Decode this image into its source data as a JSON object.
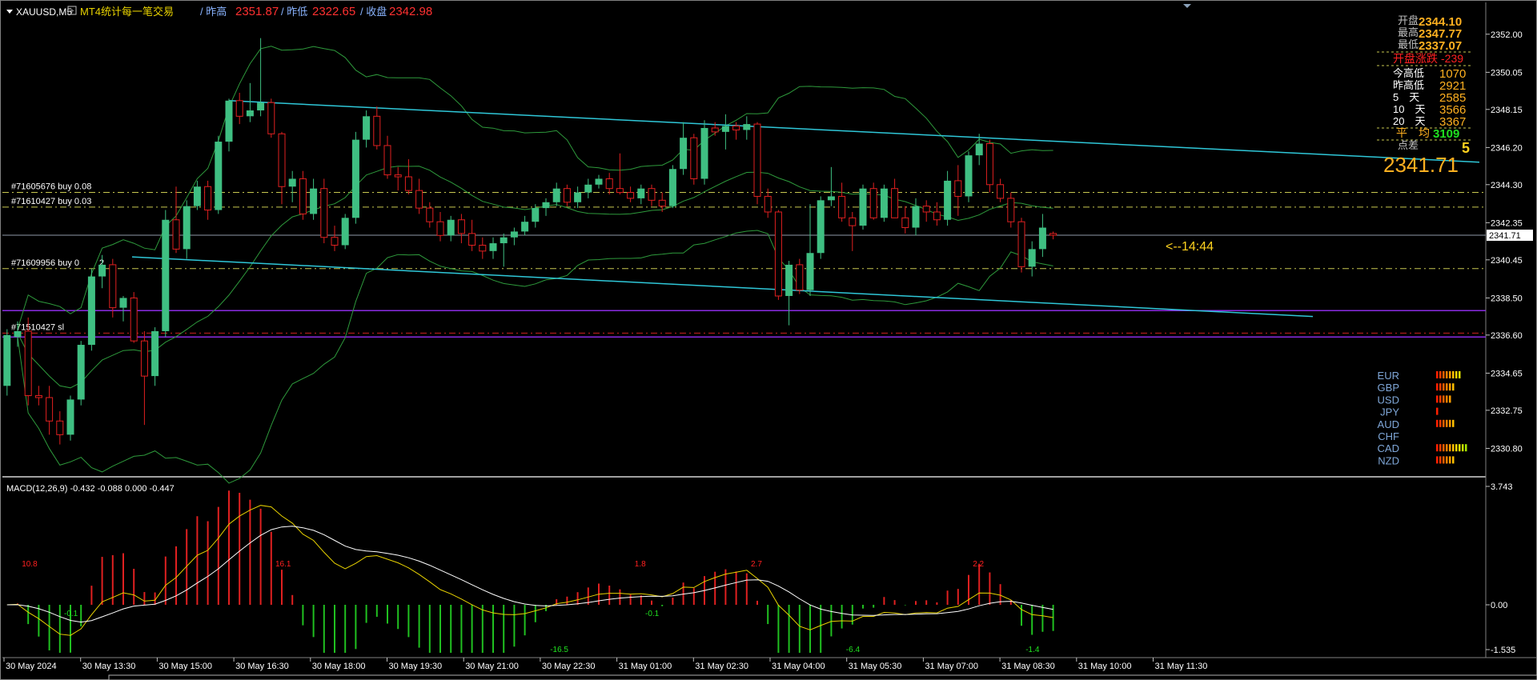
{
  "header": {
    "symbol": "XAUUSD,M5",
    "indicator_title": "MT4统计每一笔交易",
    "prev_high_label": "/ 昨高",
    "prev_high_value": "2351.87",
    "prev_low_label": "/ 昨低",
    "prev_low_value": "2322.65",
    "close_label": "/ 收盘",
    "close_value": "2342.98"
  },
  "colors": {
    "bull": "#3fbf82",
    "bear": "#e02020",
    "channel": "#2fc7d8",
    "bands": "#2e9a3c",
    "macd_signal": "#e8d200",
    "macd_main": "#ffffff",
    "orders": "#c8c850",
    "sl": "#d02020",
    "purple": "#8a2be2",
    "info_yellow": "#ffb020",
    "info_red": "#ff2020",
    "info_green": "#20e020"
  },
  "price_axis": {
    "ticks": [
      "2352.00",
      "2350.05",
      "2348.15",
      "2346.20",
      "2344.30",
      "2342.35",
      "2340.45",
      "2338.50",
      "2336.60",
      "2334.65",
      "2332.75",
      "2330.80"
    ],
    "current_price": "2341.71"
  },
  "orders": [
    {
      "label": "#71605676 buy 0.08",
      "price": 2343.9
    },
    {
      "label": "#71610427 buy 0.03",
      "price": 2343.15
    },
    {
      "label": "#71609956 buy 0",
      "price": 2340.0
    },
    {
      "label": "#71510427 sl",
      "price": 2336.7
    }
  ],
  "order_extra_char": "2",
  "countdown": "<--14:44",
  "info_panel": {
    "open_label": "开盘",
    "open_value": "2344.10",
    "high_label": "最高",
    "high_value": "2347.77",
    "low_label": "最低",
    "low_value": "2337.07",
    "open_change_label": "开盘涨跌",
    "open_change_value": "-239",
    "rows": [
      {
        "label": "今高低",
        "value": "1070"
      },
      {
        "label": "昨高低",
        "value": "2921"
      },
      {
        "label": "5　天",
        "value": "2585"
      },
      {
        "label": "10　天",
        "value": "3566"
      },
      {
        "label": "20　天",
        "value": "3367"
      }
    ],
    "avg_label": "平　均",
    "avg_value": "3109",
    "spread_label": "点差",
    "spread_value": "5",
    "big_price": "2341.71"
  },
  "currencies": [
    {
      "name": "EUR",
      "level": 8
    },
    {
      "name": "GBP",
      "level": 6
    },
    {
      "name": "USD",
      "level": 5
    },
    {
      "name": "JPY",
      "level": 1
    },
    {
      "name": "AUD",
      "level": 6
    },
    {
      "name": "CHF",
      "level": 0
    },
    {
      "name": "CAD",
      "level": 10
    },
    {
      "name": "NZD",
      "level": 6
    }
  ],
  "macd": {
    "title": "MACD(12,26,9) -0.432 -0.088 0.000 -0.447",
    "axis_top": "3.743",
    "axis_zero": "0.00",
    "axis_bottom": "-1.535",
    "labels": [
      {
        "text": "10.8",
        "bar": 2,
        "color": "red",
        "pos": "above"
      },
      {
        "text": "-0.1",
        "bar": 6,
        "color": "green",
        "pos": "below"
      },
      {
        "text": "16.1",
        "bar": 26,
        "color": "red",
        "pos": "above"
      },
      {
        "text": "-16.5",
        "bar": 52,
        "color": "green",
        "pos": "below"
      },
      {
        "text": "1.8",
        "bar": 60,
        "color": "red",
        "pos": "above"
      },
      {
        "text": "-0.1",
        "bar": 61,
        "color": "green",
        "pos": "below"
      },
      {
        "text": "2.7",
        "bar": 71,
        "color": "red",
        "pos": "above"
      },
      {
        "text": "-6.4",
        "bar": 80,
        "color": "green",
        "pos": "below"
      },
      {
        "text": "2.2",
        "bar": 92,
        "color": "red",
        "pos": "above"
      },
      {
        "text": "-1.4",
        "bar": 97,
        "color": "green",
        "pos": "below"
      }
    ]
  },
  "time_axis": [
    "30 May 2024",
    "30 May 13:30",
    "30 May 15:00",
    "30 May 16:30",
    "30 May 18:00",
    "30 May 19:30",
    "30 May 21:00",
    "30 May 22:30",
    "31 May 01:00",
    "31 May 02:30",
    "31 May 04:00",
    "31 May 05:30",
    "31 May 07:00",
    "31 May 08:30",
    "31 May 10:00",
    "31 May 11:30"
  ],
  "chart_data": {
    "type": "candlestick",
    "timeframe": "M5",
    "ohlc": [
      [
        2334,
        2336.9,
        2333.5,
        2336.6
      ],
      [
        2336.5,
        2337.3,
        2336,
        2336.8
      ],
      [
        2336.8,
        2337.5,
        2333,
        2333.5
      ],
      [
        2333.5,
        2334,
        2333,
        2333.4
      ],
      [
        2333.4,
        2334,
        2331.5,
        2332.2
      ],
      [
        2332.2,
        2332.7,
        2331,
        2331.5
      ],
      [
        2331.5,
        2333.5,
        2331.2,
        2333.3
      ],
      [
        2333.3,
        2336.3,
        2333,
        2336.1
      ],
      [
        2336.1,
        2340,
        2335.8,
        2339.6
      ],
      [
        2339.6,
        2340.7,
        2339,
        2340.2
      ],
      [
        2340.2,
        2340.5,
        2337.5,
        2338
      ],
      [
        2338,
        2338.6,
        2337.3,
        2338.5
      ],
      [
        2338.5,
        2338.8,
        2336.2,
        2336.3
      ],
      [
        2336.3,
        2336.8,
        2332,
        2334.5
      ],
      [
        2334.5,
        2337,
        2334,
        2336.8
      ],
      [
        2336.8,
        2343,
        2336.5,
        2342.5
      ],
      [
        2342.5,
        2344.2,
        2340.8,
        2341
      ],
      [
        2341,
        2343.5,
        2340.5,
        2343.2
      ],
      [
        2343.2,
        2344.5,
        2343,
        2344.2
      ],
      [
        2344.2,
        2344.5,
        2342.5,
        2343
      ],
      [
        2343,
        2346.8,
        2342.8,
        2346.5
      ],
      [
        2346.5,
        2348.7,
        2346,
        2348.6
      ],
      [
        2348.6,
        2349,
        2347.4,
        2347.8
      ],
      [
        2347.8,
        2349.5,
        2347.5,
        2348.1
      ],
      [
        2348.1,
        2351.8,
        2347.8,
        2348.5
      ],
      [
        2348.5,
        2348.7,
        2346.7,
        2346.9
      ],
      [
        2346.9,
        2347,
        2343.3,
        2344.2
      ],
      [
        2344.2,
        2345,
        2343.4,
        2344.6
      ],
      [
        2344.6,
        2345,
        2342.5,
        2342.8
      ],
      [
        2342.8,
        2344.6,
        2342.5,
        2344.1
      ],
      [
        2344.1,
        2344.6,
        2341.3,
        2341.6
      ],
      [
        2341.6,
        2342.2,
        2340.9,
        2341.2
      ],
      [
        2341.2,
        2342.8,
        2341,
        2342.6
      ],
      [
        2342.6,
        2347,
        2342.3,
        2346.6
      ],
      [
        2346.6,
        2348.1,
        2346.2,
        2347.8
      ],
      [
        2347.8,
        2348.3,
        2346.1,
        2346.3
      ],
      [
        2346.3,
        2346.8,
        2344.6,
        2344.8
      ],
      [
        2344.8,
        2345.2,
        2344,
        2344.7
      ],
      [
        2344.7,
        2345.6,
        2343.8,
        2344
      ],
      [
        2344,
        2344.6,
        2342.8,
        2343.1
      ],
      [
        2343.1,
        2343.4,
        2342.1,
        2342.4
      ],
      [
        2342.4,
        2342.9,
        2341.4,
        2341.7
      ],
      [
        2341.7,
        2342.7,
        2341.4,
        2342.5
      ],
      [
        2342.5,
        2342.8,
        2341.3,
        2341.8
      ],
      [
        2341.8,
        2342.5,
        2340.9,
        2341.2
      ],
      [
        2341.2,
        2341.6,
        2340.5,
        2340.9
      ],
      [
        2340.9,
        2341.6,
        2340.5,
        2341.3
      ],
      [
        2341.3,
        2341.8,
        2340.1,
        2341.6
      ],
      [
        2341.6,
        2342.1,
        2341.2,
        2341.9
      ],
      [
        2341.9,
        2342.7,
        2341.7,
        2342.4
      ],
      [
        2342.4,
        2343.3,
        2342.1,
        2343.1
      ],
      [
        2343.1,
        2343.6,
        2342.7,
        2343.4
      ],
      [
        2343.4,
        2344.4,
        2343.2,
        2344.1
      ],
      [
        2344.1,
        2344.3,
        2343.2,
        2343.4
      ],
      [
        2343.4,
        2344.2,
        2343.1,
        2343.9
      ],
      [
        2343.9,
        2344.6,
        2343.6,
        2344.3
      ],
      [
        2344.3,
        2344.8,
        2344.1,
        2344.6
      ],
      [
        2344.6,
        2344.9,
        2343.8,
        2344.1
      ],
      [
        2344.1,
        2345.9,
        2343.8,
        2343.9
      ],
      [
        2343.9,
        2344.2,
        2343.4,
        2343.6
      ],
      [
        2343.6,
        2344.3,
        2343.3,
        2344.1
      ],
      [
        2344.1,
        2344.3,
        2343.2,
        2343.5
      ],
      [
        2343.5,
        2343.9,
        2342.9,
        2343.2
      ],
      [
        2343.2,
        2345.3,
        2343.1,
        2345.1
      ],
      [
        2345.1,
        2347.5,
        2344.8,
        2346.7
      ],
      [
        2346.7,
        2346.9,
        2344.3,
        2344.6
      ],
      [
        2344.6,
        2347.6,
        2344.3,
        2347.2
      ],
      [
        2347.2,
        2347.5,
        2346.8,
        2347
      ],
      [
        2347,
        2347.9,
        2346.1,
        2347.3
      ],
      [
        2347.3,
        2347.5,
        2346.6,
        2347.1
      ],
      [
        2347.1,
        2347.8,
        2346.6,
        2347.4
      ],
      [
        2347.4,
        2347.5,
        2343.3,
        2343.7
      ],
      [
        2343.7,
        2344.1,
        2342.6,
        2342.9
      ],
      [
        2342.9,
        2343,
        2338.4,
        2338.6
      ],
      [
        2338.6,
        2340.4,
        2337.1,
        2340.2
      ],
      [
        2340.2,
        2340.5,
        2338.7,
        2338.9
      ],
      [
        2338.9,
        2343.3,
        2338.6,
        2340.8
      ],
      [
        2340.8,
        2343.7,
        2340.5,
        2343.5
      ],
      [
        2343.5,
        2345.2,
        2343.2,
        2343.7
      ],
      [
        2343.7,
        2344.4,
        2342.4,
        2342.6
      ],
      [
        2342.6,
        2342.9,
        2340.9,
        2342.2
      ],
      [
        2342.2,
        2344.3,
        2342,
        2344.1
      ],
      [
        2344.1,
        2344.4,
        2342.5,
        2342.6
      ],
      [
        2342.6,
        2344.3,
        2342.4,
        2344.1
      ],
      [
        2344.1,
        2344.6,
        2343.4,
        2342.6
      ],
      [
        2342.6,
        2343.2,
        2341.8,
        2342.1
      ],
      [
        2342.1,
        2343.6,
        2341.7,
        2343.2
      ],
      [
        2343.2,
        2343.5,
        2342.4,
        2342.9
      ],
      [
        2342.9,
        2343.4,
        2342.2,
        2342.5
      ],
      [
        2342.5,
        2345,
        2342.2,
        2344.5
      ],
      [
        2344.5,
        2345.3,
        2342.7,
        2343.7
      ],
      [
        2343.7,
        2346,
        2343.4,
        2345.8
      ],
      [
        2345.8,
        2346.9,
        2345.3,
        2346.4
      ],
      [
        2346.4,
        2346.6,
        2343.9,
        2344.3
      ],
      [
        2344.3,
        2344.6,
        2343.4,
        2343.6
      ],
      [
        2343.6,
        2343.9,
        2342.1,
        2342.4
      ],
      [
        2342.4,
        2342.6,
        2339.8,
        2340.1
      ],
      [
        2340.1,
        2341.4,
        2339.6,
        2341
      ],
      [
        2341,
        2342.8,
        2340.6,
        2342.1
      ],
      [
        2341.8,
        2341.9,
        2341.5,
        2341.71
      ]
    ]
  }
}
